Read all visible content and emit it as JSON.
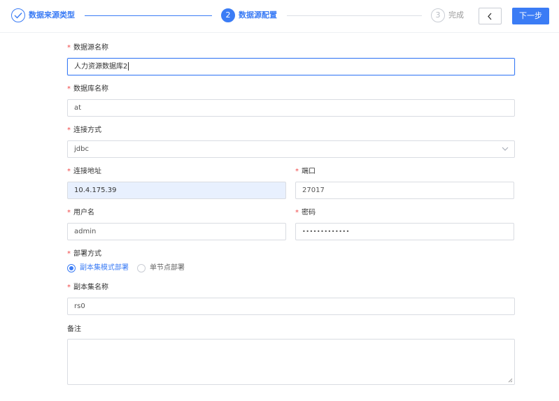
{
  "steps": [
    {
      "number": "",
      "label": "数据来源类型",
      "state": "done",
      "icon": "check-icon"
    },
    {
      "number": "2",
      "label": "数据源配置",
      "state": "active"
    },
    {
      "number": "3",
      "label": "完成",
      "state": "wait"
    }
  ],
  "toolbar": {
    "back_icon": "chevron-left-icon",
    "next_label": "下一步"
  },
  "form": {
    "datasource_name": {
      "label": "数据源名称",
      "value": "人力资源数据库2"
    },
    "database_name": {
      "label": "数据库名称",
      "value": "at"
    },
    "connection_method": {
      "label": "连接方式",
      "value": "jdbc"
    },
    "connection_address": {
      "label": "连接地址",
      "value": "10.4.175.39"
    },
    "port": {
      "label": "端口",
      "value": "27017"
    },
    "username": {
      "label": "用户名",
      "value": "admin"
    },
    "password": {
      "label": "密码",
      "value": "•••••••••••••"
    },
    "deploy_method": {
      "label": "部署方式",
      "options": [
        "副本集模式部署",
        "单节点部署"
      ],
      "selected": "副本集模式部署"
    },
    "replica_set_name": {
      "label": "副本集名称",
      "value": "rs0"
    },
    "remark": {
      "label": "备注",
      "value": ""
    }
  },
  "required_mark": "*",
  "colors": {
    "primary": "#3b7cf5",
    "required": "#f04848",
    "border": "#d9dce2",
    "autofill": "#e8f0fe"
  }
}
